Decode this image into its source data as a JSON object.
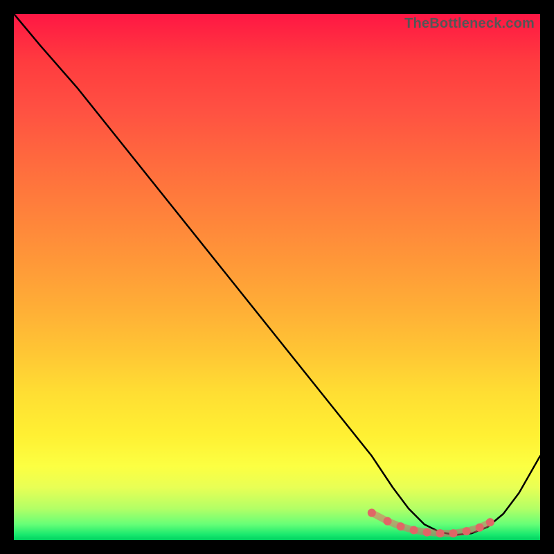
{
  "watermark": "TheBottleneck.com",
  "chart_data": {
    "type": "line",
    "title": "",
    "xlabel": "",
    "ylabel": "",
    "xlim": [
      0,
      100
    ],
    "ylim": [
      0,
      100
    ],
    "series": [
      {
        "name": "curve",
        "x": [
          0,
          5,
          12,
          20,
          30,
          40,
          50,
          60,
          68,
          72,
          75,
          78,
          81,
          84,
          87,
          90,
          93,
          96,
          100
        ],
        "y": [
          100,
          94,
          86,
          76,
          63.5,
          51,
          38.5,
          26,
          16,
          10,
          6,
          3,
          1.5,
          1,
          1.3,
          2.5,
          5,
          9,
          16
        ]
      },
      {
        "name": "highlight-dots",
        "x": [
          68,
          71,
          73.5,
          76,
          78.5,
          81,
          83.5,
          86,
          88.5,
          90.5
        ],
        "y": [
          5.2,
          3.6,
          2.6,
          1.9,
          1.5,
          1.3,
          1.3,
          1.7,
          2.4,
          3.4
        ]
      }
    ],
    "colors": {
      "curve": "#000000",
      "highlight": "#e06666"
    }
  }
}
